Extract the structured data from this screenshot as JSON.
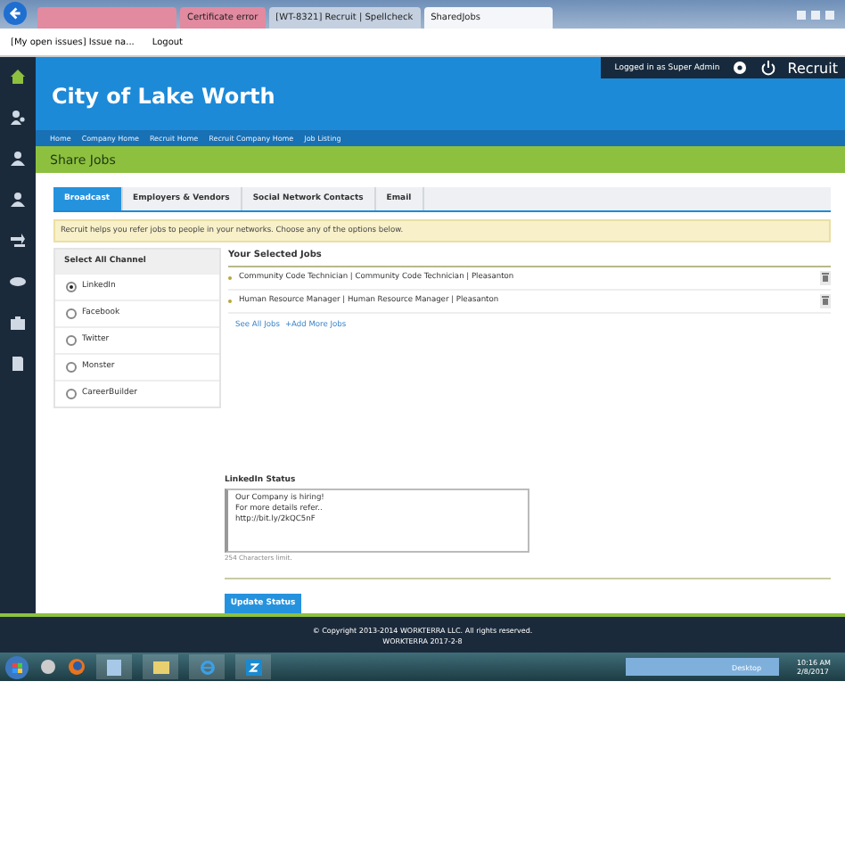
{
  "browser": {
    "tabs": [
      {
        "label": "Certificate error",
        "selected": false
      },
      {
        "label": "[WT-8321] Recruit | Spellcheck",
        "selected": false
      },
      {
        "label": "SharedJobs",
        "selected": true
      }
    ],
    "bookmarks": [
      "[My open issues] Issue na...",
      "Logout"
    ]
  },
  "header": {
    "title": "City of Lake Worth",
    "user": "Logged in as Super Admin",
    "app": "Recruit"
  },
  "breadcrumb": [
    "Home",
    "Company Home",
    "Recruit Home",
    "Recruit Company Home",
    "Job Listing"
  ],
  "page_title": "Share Jobs",
  "tabs": [
    {
      "label": "Broadcast",
      "selected": true
    },
    {
      "label": "Employers & Vendors",
      "selected": false
    },
    {
      "label": "Social Network Contacts",
      "selected": false
    },
    {
      "label": "Email",
      "selected": false
    }
  ],
  "info": "Recruit helps you refer jobs to people in your networks. Choose any of the options below.",
  "channels": {
    "header": "Select All Channel",
    "items": [
      {
        "label": "LinkedIn",
        "selected": true
      },
      {
        "label": "Facebook",
        "selected": false
      },
      {
        "label": "Twitter",
        "selected": false
      },
      {
        "label": "Monster",
        "selected": false
      },
      {
        "label": "CareerBuilder",
        "selected": false
      }
    ]
  },
  "selected_jobs": {
    "title": "Your Selected Jobs",
    "jobs": [
      "Community Code Technician | Community Code Technician | Pleasanton",
      "Human Resource Manager | Human Resource Manager | Pleasanton"
    ],
    "links": [
      "See All Jobs",
      "+Add More Jobs"
    ]
  },
  "status": {
    "label": "LinkedIn Status",
    "value": "Our Company is hiring!\nFor more details refer..\nhttp://bit.ly/2kQC5nF",
    "hint": "254 Characters limit."
  },
  "button": "Update Status",
  "footer": {
    "copyright": "© Copyright 2013-2014 WORKTERRA LLC. All rights reserved.",
    "version": "WORKTERRA 2017-2-8"
  },
  "taskbar": {
    "desktop": "Desktop",
    "time": "10:16 AM",
    "date": "2/8/2017"
  }
}
